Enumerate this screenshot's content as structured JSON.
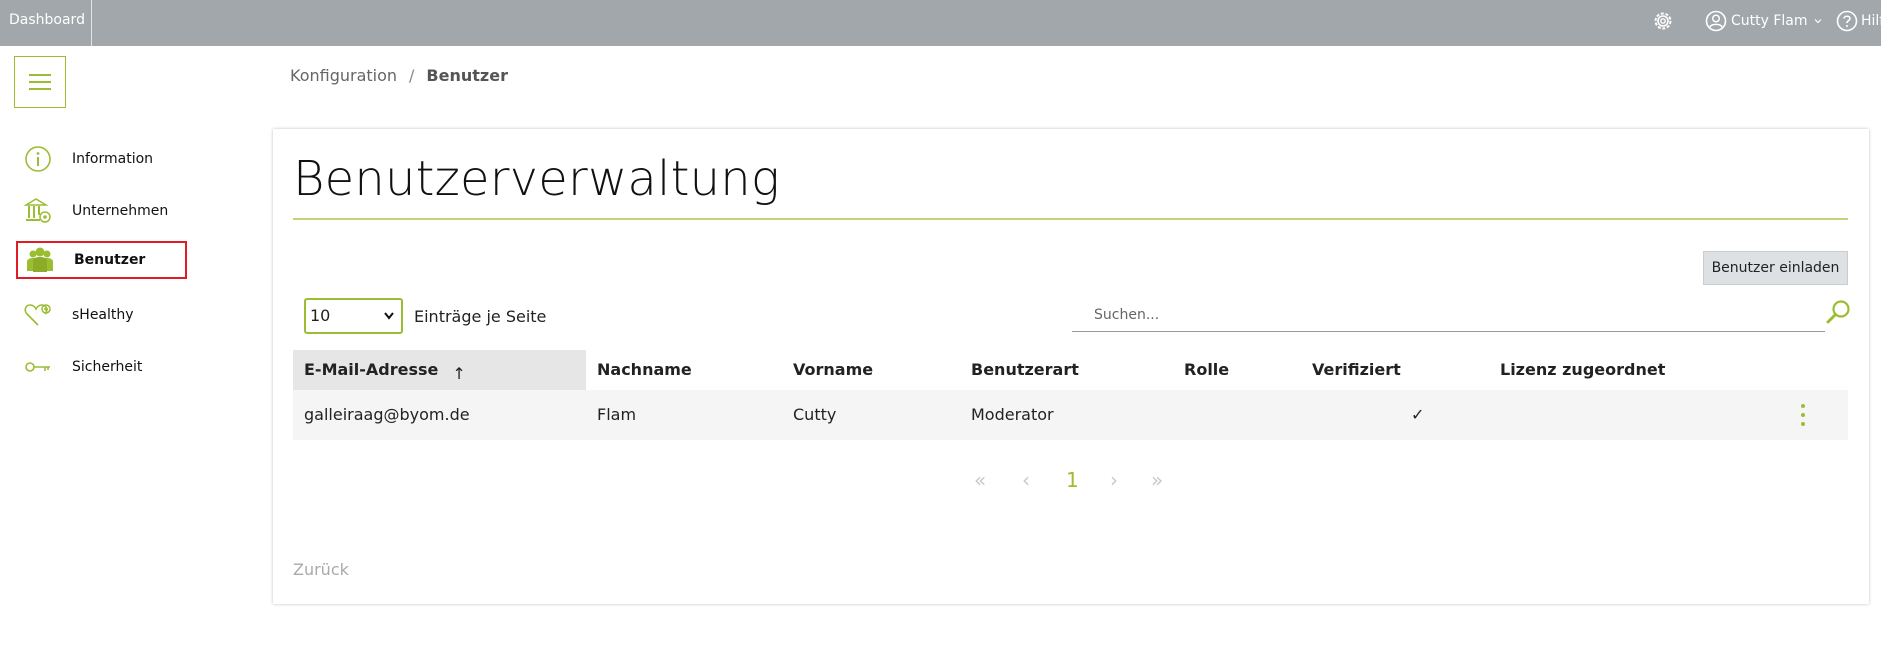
{
  "topbar": {
    "brand": "Dashboard",
    "user_name": "Cutty Flam",
    "help_label": "Hilfe"
  },
  "sidebar": {
    "items": [
      {
        "label": "Information",
        "icon": "info-icon"
      },
      {
        "label": "Unternehmen",
        "icon": "company-building-icon"
      },
      {
        "label": "Benutzer",
        "icon": "users-icon",
        "active": true
      },
      {
        "label": "sHealthy",
        "icon": "heart-health-icon"
      },
      {
        "label": "Sicherheit",
        "icon": "key-icon"
      }
    ]
  },
  "breadcrumb": {
    "parent": "Konfiguration",
    "separator": "/",
    "current": "Benutzer"
  },
  "main": {
    "title": "Benutzerverwaltung",
    "invite_button": "Benutzer einladen",
    "per_page_value": "10",
    "per_page_label": "Einträge je Seite",
    "search_placeholder": "Suchen...",
    "table": {
      "columns": [
        "E-Mail-Adresse",
        "Nachname",
        "Vorname",
        "Benutzerart",
        "Rolle",
        "Verifiziert",
        "Lizenz zugeordnet"
      ],
      "sort_indicator": "↑",
      "rows": [
        {
          "email": "galleiraag@byom.de",
          "nachname": "Flam",
          "vorname": "Cutty",
          "benutzerart": "Moderator",
          "rolle": "",
          "verifiziert": "✓",
          "lizenz": ""
        }
      ]
    },
    "pagination": {
      "first": "«",
      "prev": "‹",
      "current": "1",
      "next": "›",
      "last": "»"
    },
    "back_link": "Zurück"
  },
  "colors": {
    "accent": "#9bbd32",
    "topbar": "#a1a7aa",
    "active_outline": "#e01c24"
  }
}
